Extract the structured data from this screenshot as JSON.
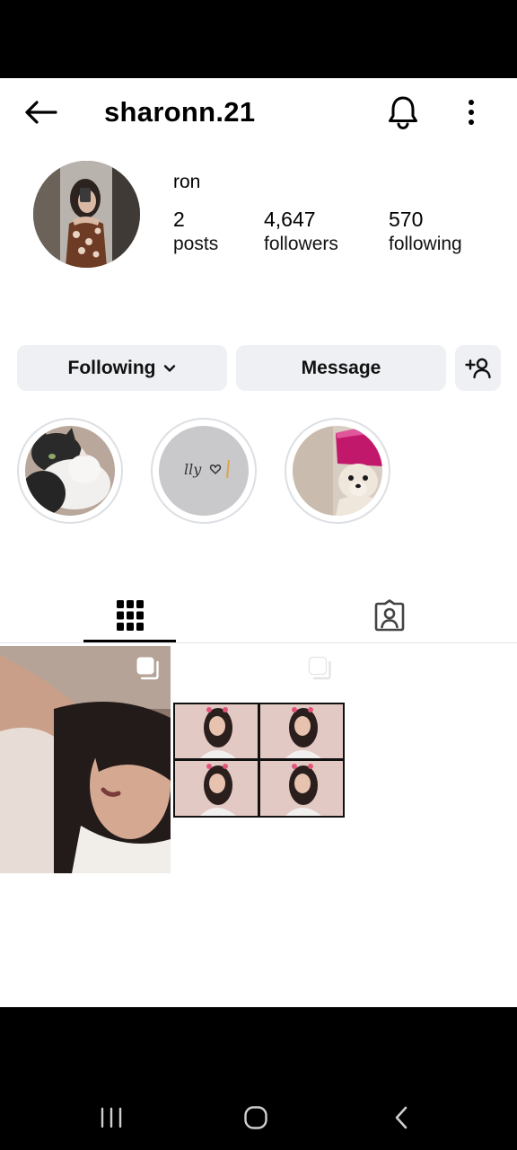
{
  "header": {
    "username": "sharonn.21",
    "icons": {
      "back": "arrow-left-icon",
      "notifications": "bell-icon",
      "more": "more-vertical-icon"
    }
  },
  "profile": {
    "display_name": "ron",
    "stats": [
      {
        "value": "2",
        "label": "posts"
      },
      {
        "value": "4,647",
        "label": "followers"
      },
      {
        "value": "570",
        "label": "following"
      }
    ]
  },
  "actions": {
    "following_label": "Following",
    "message_label": "Message",
    "icons": {
      "chevron": "chevron-down-icon",
      "add_user": "add-user-icon"
    }
  },
  "highlights": [
    {
      "subject": "cats"
    },
    {
      "subject": "handwritten note",
      "note_text": "lly"
    },
    {
      "subject": "chihuahua in pink hat"
    }
  ],
  "tabs": [
    {
      "name": "posts-grid",
      "icon": "grid-icon",
      "active": true
    },
    {
      "name": "tagged",
      "icon": "tagged-person-icon",
      "active": false
    }
  ],
  "posts": [
    {
      "type": "carousel",
      "icon": "multiple-images-icon"
    },
    {
      "type": "carousel",
      "icon": "multiple-images-icon"
    }
  ],
  "system_nav": {
    "icons": [
      "recent-apps-icon",
      "home-icon",
      "back-icon"
    ]
  },
  "colors": {
    "button_bg": "#eef0f4",
    "text": "#000000",
    "highlight_ring": "#dcdfe3",
    "tab_indicator": "#000000"
  }
}
